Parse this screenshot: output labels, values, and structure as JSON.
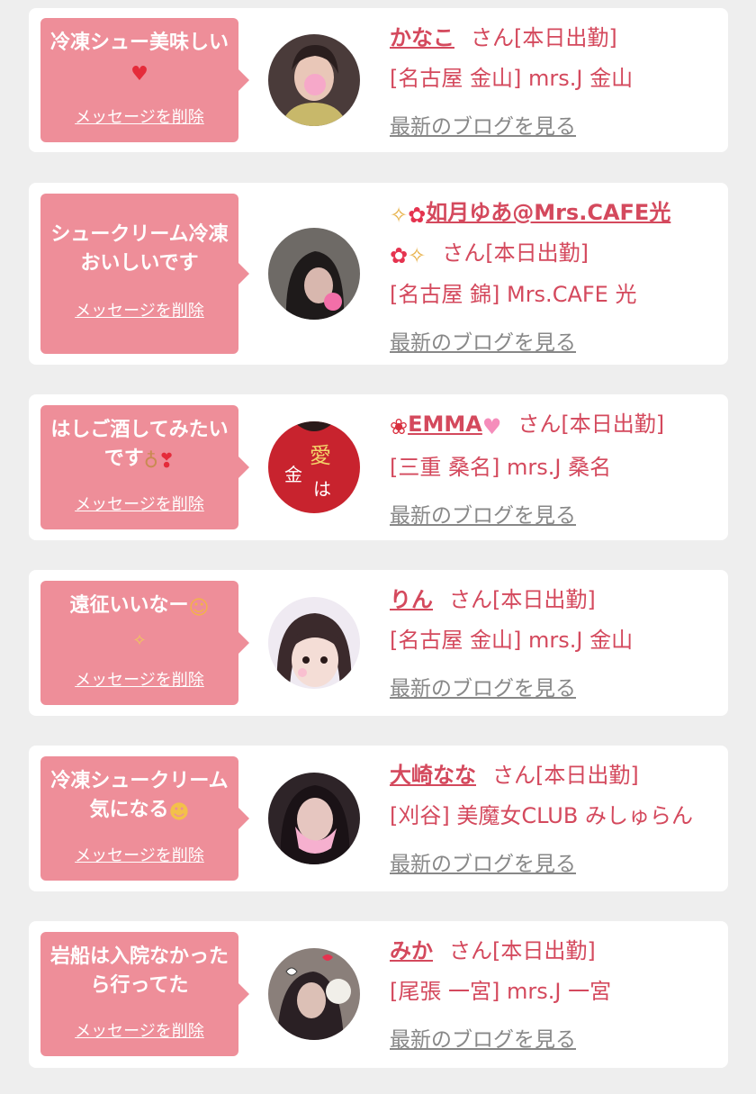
{
  "delete_label": "メッセージを削除",
  "blog_label": "最新のブログを見る",
  "name_suffix": "さん[本日出勤]",
  "cards": [
    {
      "message": "冷凍シュー美味しい",
      "message_icon": "heart-icon",
      "name": "かなこ",
      "shop": "[名古屋 金山] mrs.J 金山"
    },
    {
      "message": "シュークリーム冷凍おいしいです",
      "name": "如月ゆあ@Mrs.CAFE光",
      "name_icons": [
        "sparkles-icon",
        "hibiscus-icon"
      ],
      "shop": "[名古屋 錦] Mrs.CAFE 光"
    },
    {
      "message": "はしご酒してみたいです",
      "message_icon": "sake-bottle-icon",
      "name": "EMMA",
      "name_icons": [
        "rose-icon",
        "pink-heart-icon"
      ],
      "shop": "[三重 桑名] mrs.J 桑名"
    },
    {
      "message": "遠征いいなー",
      "message_icon": "smile-icon",
      "name": "りん",
      "shop": "[名古屋 金山] mrs.J 金山"
    },
    {
      "message": "冷凍シュークリーム気になる",
      "message_icon": "drooling-face-icon",
      "name": "大崎なな",
      "shop": "[刈谷] 美魔女CLUB みしゅらん"
    },
    {
      "message": "岩船は入院なかったら行ってた",
      "name": "みか",
      "shop": "[尾張 一宮] mrs.J 一宮"
    }
  ],
  "colors": {
    "accent": "#d4495d",
    "bubble": "#ee8e99",
    "muted": "#888888",
    "background": "#eeeeee"
  }
}
